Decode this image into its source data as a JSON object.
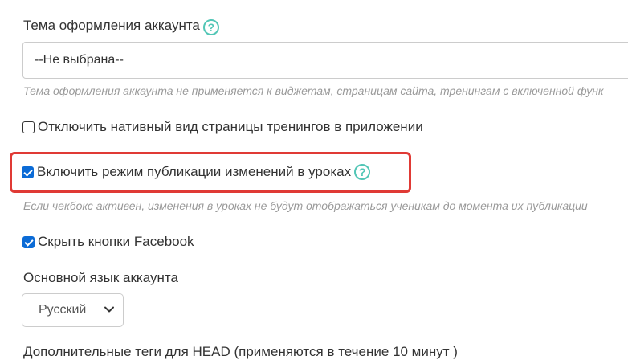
{
  "theme": {
    "label": "Тема оформления аккаунта",
    "help_icon": "?",
    "selected_value": "--Не выбрана--",
    "hint": "Тема оформления аккаунта не применяется к виджетам, страницам сайта, тренингам с включенной функ"
  },
  "native_view": {
    "label": "Отключить нативный вид страницы тренингов в приложении",
    "checked": false
  },
  "publish_mode": {
    "label": "Включить режим публикации изменений в уроках",
    "help_icon": "?",
    "checked": true,
    "hint": "Если чекбокс активен, изменения в уроках не будут отображаться ученикам до момента их публикации"
  },
  "hide_facebook": {
    "label": "Скрыть кнопки Facebook",
    "checked": true
  },
  "language": {
    "label": "Основной язык аккаунта",
    "selected_value": "Русский"
  },
  "head_tags": {
    "label": "Дополнительные теги для HEAD (применяются в течение 10 минут )"
  },
  "colors": {
    "accent_help": "#52c6b6",
    "checkbox_checked": "#0b6bd6",
    "highlight": "#e03a35"
  },
  "icons": {
    "help": "question-circle-icon",
    "chevron": "chevron-down-icon",
    "check": "checkmark-icon"
  }
}
